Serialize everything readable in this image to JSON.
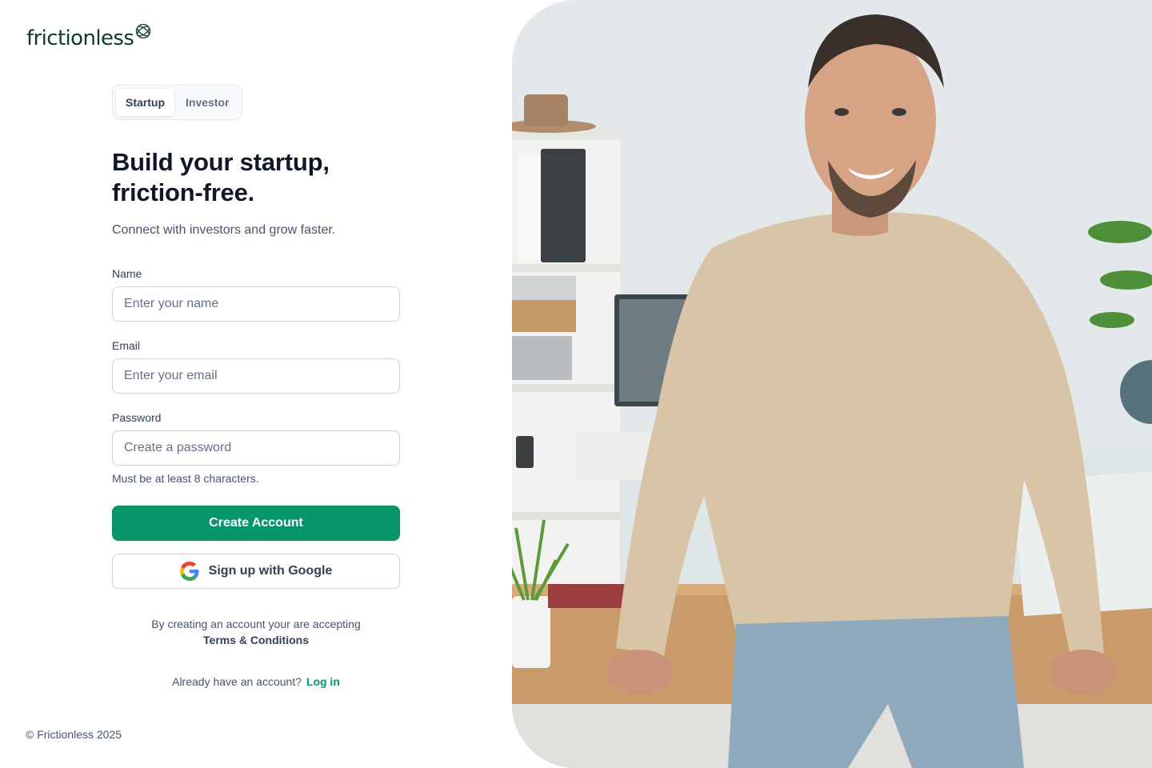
{
  "brand": {
    "name": "frictionless",
    "mark_icon": "orbit-logo-icon"
  },
  "tabs": [
    {
      "label": "Startup",
      "active": true
    },
    {
      "label": "Investor",
      "active": false
    }
  ],
  "hero": {
    "headline_line1": "Build your startup,",
    "headline_line2": "friction-free.",
    "subheadline": "Connect with investors and grow faster."
  },
  "form": {
    "name": {
      "label": "Name",
      "placeholder": "Enter your name",
      "value": ""
    },
    "email": {
      "label": "Email",
      "placeholder": "Enter your email",
      "value": ""
    },
    "password": {
      "label": "Password",
      "placeholder": "Create a password",
      "value": "",
      "hint": "Must be at least 8 characters."
    },
    "submit_label": "Create Account",
    "google_label": "Sign up with Google",
    "google_icon": "google-icon"
  },
  "terms": {
    "text": "By creating an account your are accepting",
    "link": "Terms & Conditions"
  },
  "login": {
    "prompt": "Already have an account?",
    "link": "Log in"
  },
  "footer": {
    "copyright": "© Frictionless 2025"
  },
  "colors": {
    "primary": "#079669",
    "brand_text": "#0d3b32",
    "heading": "#101828",
    "body": "#475467",
    "border": "#d0d5dd"
  }
}
